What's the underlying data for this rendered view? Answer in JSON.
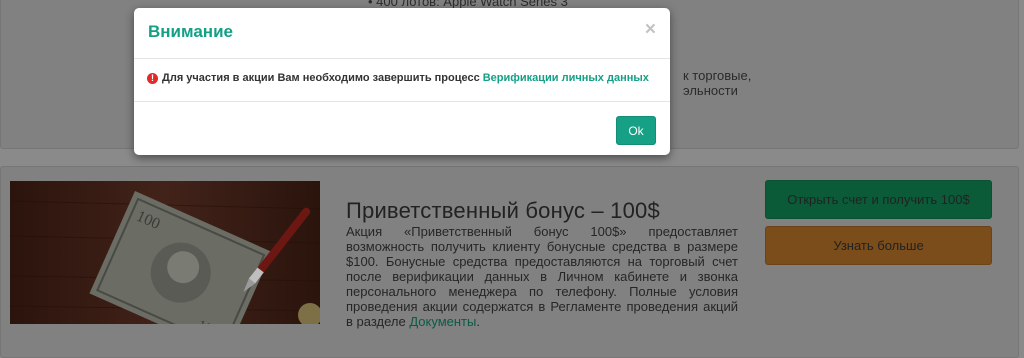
{
  "background": {
    "bullet_text": "• 400 лотов: Apple Watch Series 3",
    "side_text": "к торговые, эльности"
  },
  "promo": {
    "title": "Приветственный бонус – 100$",
    "description": "Акция «Приветственный бонус 100$» предоставляет возможность получить клиенту бонусные средства в размере $100. Бонусные средства предоставляются на торговый счет после верификации данных в Личном кабинете и звонка персонального менеджера по телефону. Полные условия проведения акции содержатся в Регламенте проведения акций в разделе",
    "documents_link": "Документы",
    "description_end": ".",
    "open_account_button": "Открыть счет и получить 100$",
    "learn_more_button": "Узнать больше"
  },
  "modal": {
    "title": "Внимание",
    "close_symbol": "×",
    "message": "Для участия в акции Вам необходимо завершить процесс",
    "message_link": "Верификации личных данных",
    "ok_button": "Ok"
  },
  "colors": {
    "accent": "#16a085",
    "error": "#e22a2a",
    "open_button": "#0b5b39",
    "more_button": "#7a4d1b"
  }
}
